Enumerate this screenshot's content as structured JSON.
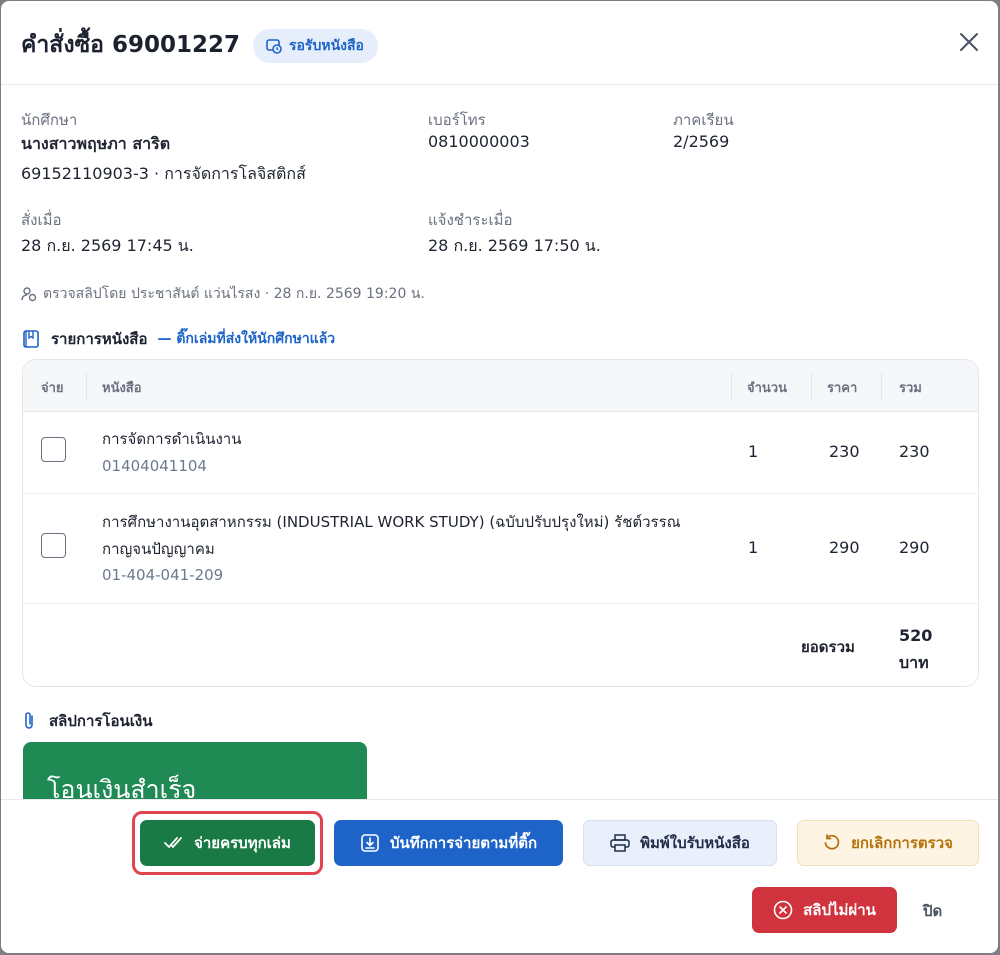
{
  "header": {
    "title": "คำสั่งซื้อ 69001227",
    "status": "รอรับหนังสือ"
  },
  "info": {
    "student_label": "นักศึกษา",
    "student_name": "นางสาวพฤษภา สาริต",
    "student_detail": "69152110903-3 · การจัดการโลจิสติกส์",
    "phone_label": "เบอร์โทร",
    "phone_value": "0810000003",
    "term_label": "ภาคเรียน",
    "term_value": "2/2569",
    "ordered_label": "สั่งเมื่อ",
    "ordered_value": "28 ก.ย. 2569 17:45 น.",
    "paid_label": "แจ้งชำระเมื่อ",
    "paid_value": "28 ก.ย. 2569 17:50 น.",
    "reviewer": "ตรวจสลิปโดย ประชาสันต์ แว่นไรสง · 28 ก.ย. 2569 19:20 น."
  },
  "books_section": {
    "title": "รายการหนังสือ",
    "subtitle": "— ติ๊กเล่มที่ส่งให้นักศึกษาแล้ว",
    "columns": {
      "pay": "จ่าย",
      "book": "หนังสือ",
      "qty": "จำนวน",
      "price": "ราคา",
      "total": "รวม"
    },
    "rows": [
      {
        "title": "การจัดการดำเนินงาน",
        "code": "01404041104",
        "qty": "1",
        "price": "230",
        "total": "230"
      },
      {
        "title": "การศึกษางานอุตสาหกรรม (INDUSTRIAL WORK STUDY) (ฉบับปรับปรุงใหม่) รัชต์วรรณ กาญจนปัญญาคม",
        "code": "01-404-041-209",
        "qty": "1",
        "price": "290",
        "total": "290"
      }
    ],
    "total_label": "ยอดรวม",
    "total_value": "520",
    "total_unit": "บาท"
  },
  "slip_section": {
    "title": "สลิปการโอนเงิน",
    "slip_text": "โอนเงินสำเร็จ"
  },
  "actions": {
    "pay_all": "จ่ายครบทุกเล่ม",
    "save_checked": "บันทึกการจ่ายตามที่ติ๊ก",
    "print_receipt": "พิมพ์ใบรับหนังสือ",
    "cancel_review": "ยกเลิกการตรวจ",
    "slip_rejected": "สลิปไม่ผ่าน",
    "close": "ปิด"
  }
}
